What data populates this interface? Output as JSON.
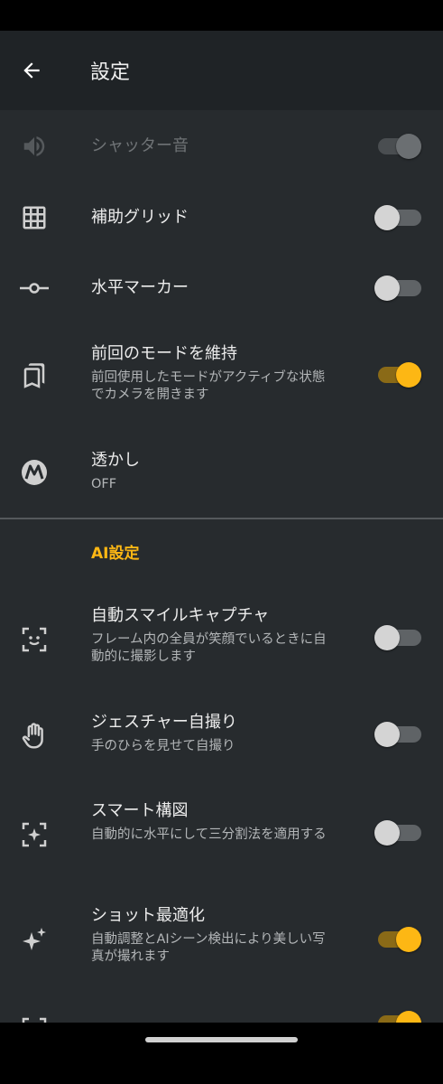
{
  "app_bar": {
    "title": "設定"
  },
  "rows": [
    {
      "title": "シャッター音",
      "subtitle": "",
      "icon": "speaker-icon",
      "toggle": "on",
      "disabled": true
    },
    {
      "title": "補助グリッド",
      "subtitle": "",
      "icon": "grid-icon",
      "toggle": "off"
    },
    {
      "title": "水平マーカー",
      "subtitle": "",
      "icon": "level-marker-icon",
      "toggle": "off"
    },
    {
      "title": "前回のモードを維持",
      "subtitle": "前回使用したモードがアクティブな状態でカメラを開きます",
      "icon": "bookmarks-icon",
      "toggle": "on"
    },
    {
      "title": "透かし",
      "subtitle": "OFF",
      "icon": "motorola-logo-icon",
      "toggle": null
    }
  ],
  "ai_section": {
    "header": "AI設定"
  },
  "ai_rows": [
    {
      "title": "自動スマイルキャプチャ",
      "subtitle": "フレーム内の全員が笑顔でいるときに自動的に撮影します",
      "icon": "smile-capture-icon",
      "toggle": "off"
    },
    {
      "title": "ジェスチャー自撮り",
      "subtitle": "手のひらを見せて自撮り",
      "icon": "palm-icon",
      "toggle": "off"
    },
    {
      "title": "スマート構図",
      "subtitle": "自動的に水平にして三分割法を適用する",
      "icon": "smart-composition-icon",
      "toggle": "off"
    },
    {
      "title": "ショット最適化",
      "subtitle": "自動調整とAIシーン検出により美しい写真が撮れます",
      "icon": "sparkle-icon",
      "toggle": "on"
    },
    {
      "title": "",
      "subtitle": "",
      "icon": "focus-frame-icon",
      "toggle": "on"
    }
  ],
  "colors": {
    "accent": "#fdb714",
    "background": "#272b2e",
    "app_bar": "#1f2326"
  }
}
